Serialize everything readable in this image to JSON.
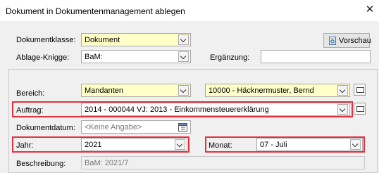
{
  "window": {
    "title": "Dokument in Dokumentenmanagement ablegen",
    "close_glyph": "✕"
  },
  "fields": {
    "dokumentklasse": {
      "label": "Dokumentklasse:",
      "value": "Dokument"
    },
    "ablage_knigge": {
      "label": "Ablage-Knigge:",
      "value": "BaM:"
    },
    "ergaenzung": {
      "label": "Ergänzung:",
      "value": ""
    },
    "bereich": {
      "label": "Bereich:",
      "value": "Mandanten",
      "mandant": "10000 - Häcknermuster, Bernd"
    },
    "auftrag": {
      "label": "Auftrag:",
      "value": "2014 - 000044 VJ: 2013 - Einkommensteuererklärung"
    },
    "dokumentdatum": {
      "label": "Dokumentdatum:",
      "placeholder": "<Keine Angabe>"
    },
    "jahr": {
      "label": "Jahr:",
      "value": "2021"
    },
    "monat": {
      "label": "Monat:",
      "value": "07 - Juli"
    },
    "beschreibung": {
      "label": "Beschreibung:",
      "value": "BaM: 2021/7"
    }
  },
  "toolbar": {
    "vorschau_label": "Vorschau"
  },
  "colors": {
    "highlight_red": "#e0333d",
    "mandatory_yellow": "#ffffc8"
  }
}
